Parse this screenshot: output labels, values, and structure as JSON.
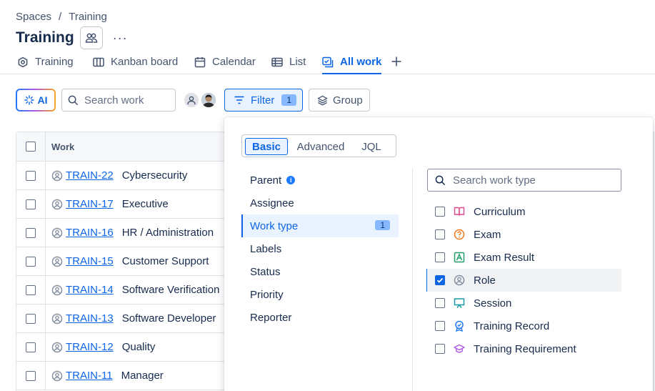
{
  "breadcrumb": {
    "root": "Spaces",
    "separator": "/",
    "current": "Training"
  },
  "header": {
    "title": "Training",
    "more": "···"
  },
  "tabs": [
    {
      "label": "Training",
      "icon": "gear-icon"
    },
    {
      "label": "Kanban board",
      "icon": "board-icon"
    },
    {
      "label": "Calendar",
      "icon": "calendar-icon"
    },
    {
      "label": "List",
      "icon": "list-icon"
    },
    {
      "label": "All work",
      "icon": "all-work-icon",
      "active": true
    }
  ],
  "toolbar": {
    "ai_label": "AI",
    "search_placeholder": "Search work",
    "filter_label": "Filter",
    "filter_count": "1",
    "group_label": "Group"
  },
  "table": {
    "header": "Work",
    "rows": [
      {
        "key": "TRAIN-22",
        "summary": "Cybersecurity"
      },
      {
        "key": "TRAIN-17",
        "summary": "Executive"
      },
      {
        "key": "TRAIN-16",
        "summary": "HR / Administration"
      },
      {
        "key": "TRAIN-15",
        "summary": "Customer Support"
      },
      {
        "key": "TRAIN-14",
        "summary": "Software Verification"
      },
      {
        "key": "TRAIN-13",
        "summary": "Software Developer"
      },
      {
        "key": "TRAIN-12",
        "summary": "Quality"
      },
      {
        "key": "TRAIN-11",
        "summary": "Manager"
      }
    ]
  },
  "filter_panel": {
    "modes": [
      "Basic",
      "Advanced",
      "JQL"
    ],
    "active_mode": "Basic",
    "facets": [
      {
        "label": "Parent",
        "info": "i"
      },
      {
        "label": "Assignee"
      },
      {
        "label": "Work type",
        "count": "1",
        "active": true
      },
      {
        "label": "Labels"
      },
      {
        "label": "Status"
      },
      {
        "label": "Priority"
      },
      {
        "label": "Reporter"
      }
    ],
    "search_placeholder": "Search work type",
    "options": [
      {
        "label": "Curriculum",
        "checked": false,
        "icon": "book-icon",
        "color": "#e2478c"
      },
      {
        "label": "Exam",
        "checked": false,
        "icon": "question-icon",
        "color": "#f5791f"
      },
      {
        "label": "Exam Result",
        "checked": false,
        "icon": "chart-icon",
        "color": "#22a06b"
      },
      {
        "label": "Role",
        "checked": true,
        "icon": "person-icon",
        "color": "#8590a2"
      },
      {
        "label": "Session",
        "checked": false,
        "icon": "presentation-icon",
        "color": "#1d9aaa"
      },
      {
        "label": "Training Record",
        "checked": false,
        "icon": "badge-icon",
        "color": "#1d7afc"
      },
      {
        "label": "Training Requirement",
        "checked": false,
        "icon": "graduation-cap-icon",
        "color": "#af59e1"
      }
    ]
  },
  "colors": {
    "accent": "#0c66e4",
    "text": "#172b4d",
    "muted": "#44546f"
  }
}
